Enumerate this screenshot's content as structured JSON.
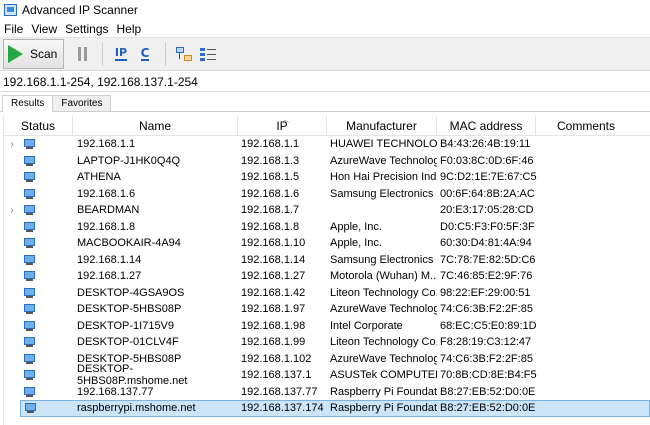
{
  "window": {
    "title": "Advanced IP Scanner"
  },
  "menu": [
    "File",
    "View",
    "Settings",
    "Help"
  ],
  "toolbar": {
    "scan_label": "Scan",
    "ip_label": "IP",
    "c_label": "C"
  },
  "address": {
    "value": "192.168.1.1-254, 192.168.137.1-254"
  },
  "tabs": [
    {
      "label": "Results",
      "active": true
    },
    {
      "label": "Favorites",
      "active": false
    }
  ],
  "table": {
    "columns": [
      "Status",
      "Name",
      "IP",
      "Manufacturer",
      "MAC address",
      "Comments"
    ],
    "rows": [
      {
        "expandable": true,
        "name": "192.168.1.1",
        "ip": "192.168.1.1",
        "manufacturer": "HUAWEI TECHNOLOG...",
        "mac": "B4:43:26:4B:19:11",
        "comments": ""
      },
      {
        "expandable": false,
        "name": "LAPTOP-J1HK0Q4Q",
        "ip": "192.168.1.3",
        "manufacturer": "AzureWave Technolog...",
        "mac": "F0:03:8C:0D:6F:46",
        "comments": ""
      },
      {
        "expandable": false,
        "name": "ATHENA",
        "ip": "192.168.1.5",
        "manufacturer": "Hon Hai Precision Ind...",
        "mac": "9C:D2:1E:7E:67:C5",
        "comments": ""
      },
      {
        "expandable": false,
        "name": "192.168.1.6",
        "ip": "192.168.1.6",
        "manufacturer": "Samsung Electronics ...",
        "mac": "00:6F:64:8B:2A:AC",
        "comments": ""
      },
      {
        "expandable": true,
        "name": "BEARDMAN",
        "ip": "192.168.1.7",
        "manufacturer": "",
        "mac": "20:E3:17:05:28:CD",
        "comments": ""
      },
      {
        "expandable": false,
        "name": "192.168.1.8",
        "ip": "192.168.1.8",
        "manufacturer": "Apple, Inc.",
        "mac": "D0:C5:F3:F0:5F:3F",
        "comments": ""
      },
      {
        "expandable": false,
        "name": "MACBOOKAIR-4A94",
        "ip": "192.168.1.10",
        "manufacturer": "Apple, Inc.",
        "mac": "60:30:D4:81:4A:94",
        "comments": ""
      },
      {
        "expandable": false,
        "name": "192.168.1.14",
        "ip": "192.168.1.14",
        "manufacturer": "Samsung Electronics ...",
        "mac": "7C:78:7E:82:5D:C6",
        "comments": ""
      },
      {
        "expandable": false,
        "name": "192.168.1.27",
        "ip": "192.168.1.27",
        "manufacturer": "Motorola (Wuhan) M...",
        "mac": "7C:46:85:E2:9F:76",
        "comments": ""
      },
      {
        "expandable": false,
        "name": "DESKTOP-4GSA9OS",
        "ip": "192.168.1.42",
        "manufacturer": "Liteon Technology Co...",
        "mac": "98:22:EF:29:00:51",
        "comments": ""
      },
      {
        "expandable": false,
        "name": "DESKTOP-5HBS08P",
        "ip": "192.168.1.97",
        "manufacturer": "AzureWave Technolog...",
        "mac": "74:C6:3B:F2:2F:85",
        "comments": ""
      },
      {
        "expandable": false,
        "name": "DESKTOP-1I715V9",
        "ip": "192.168.1.98",
        "manufacturer": "Intel Corporate",
        "mac": "68:EC:C5:E0:89:1D",
        "comments": ""
      },
      {
        "expandable": false,
        "name": "DESKTOP-01CLV4F",
        "ip": "192.168.1.99",
        "manufacturer": "Liteon Technology Co...",
        "mac": "F8:28:19:C3:12:47",
        "comments": ""
      },
      {
        "expandable": false,
        "name": "DESKTOP-5HBS08P",
        "ip": "192.168.1.102",
        "manufacturer": "AzureWave Technolog...",
        "mac": "74:C6:3B:F2:2F:85",
        "comments": ""
      },
      {
        "expandable": false,
        "name": "DESKTOP-5HBS08P.mshome.net",
        "ip": "192.168.137.1",
        "manufacturer": "ASUSTek COMPUTER I...",
        "mac": "70:8B:CD:8E:B4:F5",
        "comments": ""
      },
      {
        "expandable": false,
        "name": "192.168.137.77",
        "ip": "192.168.137.77",
        "manufacturer": "Raspberry Pi Foundati...",
        "mac": "B8:27:EB:52:D0:0E",
        "comments": ""
      },
      {
        "expandable": false,
        "name": "raspberrypi.mshome.net",
        "ip": "192.168.137.174",
        "manufacturer": "Raspberry Pi Foundati...",
        "mac": "B8:27:EB:52:D0:0E",
        "comments": "",
        "selected": true
      }
    ]
  }
}
